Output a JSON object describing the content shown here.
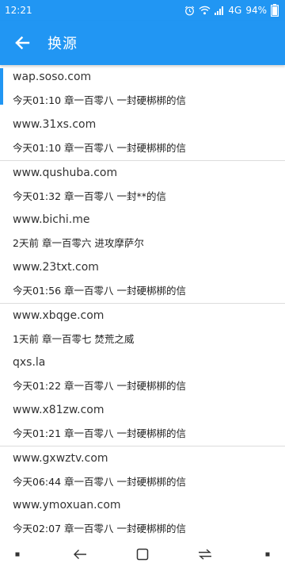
{
  "status_bar": {
    "time": "12:21",
    "network": "4G",
    "battery": "94%"
  },
  "app_bar": {
    "title": "换源"
  },
  "sources": [
    {
      "name": "wap.soso.com",
      "time": "今天01:10",
      "chapter": "章一百零八 一封硬梆梆的信",
      "selected": true
    },
    {
      "name": "www.31xs.com",
      "time": "今天01:10",
      "chapter": "章一百零八 一封硬梆梆的信"
    },
    {
      "name": "www.qushuba.com",
      "time": "今天01:32",
      "chapter": "章一百零八 一封**的信"
    },
    {
      "name": "www.bichi.me",
      "time": "2天前",
      "chapter": "章一百零六 进攻摩萨尔"
    },
    {
      "name": "www.23txt.com",
      "time": "今天01:56",
      "chapter": "章一百零八 一封硬梆梆的信"
    },
    {
      "name": "www.xbqge.com",
      "time": "1天前",
      "chapter": "章一百零七 焚荒之威"
    },
    {
      "name": "qxs.la",
      "time": "今天01:22",
      "chapter": "章一百零八 一封硬梆梆的信"
    },
    {
      "name": "www.x81zw.com",
      "time": "今天01:21",
      "chapter": "章一百零八 一封硬梆梆的信"
    },
    {
      "name": "www.gxwztv.com",
      "time": "今天06:44",
      "chapter": "章一百零八 一封硬梆梆的信"
    },
    {
      "name": "www.ymoxuan.com",
      "time": "今天02:07",
      "chapter": "章一百零八 一封硬梆梆的信"
    }
  ],
  "colors": {
    "primary": "#2196f3",
    "divider": "#dcdcdc"
  },
  "icons": {
    "back": "arrow-left-icon",
    "nav": [
      "menu-dot-icon",
      "nav-back-icon",
      "nav-home-icon",
      "nav-switch-icon",
      "nav-dot-icon"
    ]
  }
}
